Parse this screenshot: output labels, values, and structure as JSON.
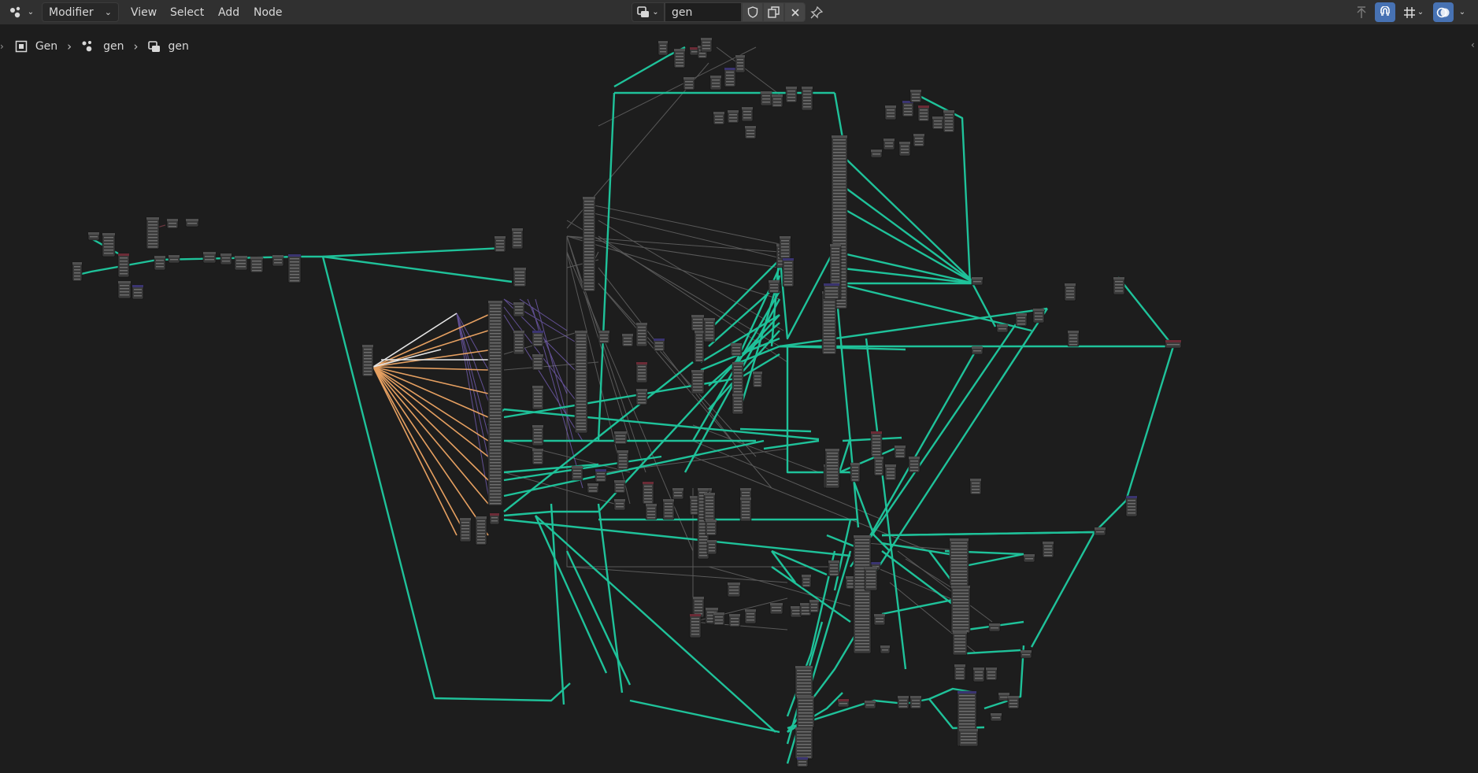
{
  "header": {
    "editor_type_icon": "node-editor-icon",
    "mode_label": "Modifier",
    "menus": [
      "View",
      "Select",
      "Add",
      "Node"
    ],
    "node_tree_name": "gen",
    "node_tree_icon": "geometry-nodes-icon",
    "right_icons": [
      "parent-node-icon",
      "snap-icon",
      "grid-overlay-icon",
      "overlay-icon"
    ]
  },
  "breadcrumb": {
    "items": [
      {
        "icon": "mesh-object-icon",
        "label": "Gen"
      },
      {
        "icon": "modifier-icon",
        "label": "gen"
      },
      {
        "icon": "node-tree-icon",
        "label": "gen"
      }
    ]
  },
  "colors": {
    "link_geometry": "#1fc29a",
    "link_float": "#8c8c8c",
    "link_vector": "#8066c9",
    "link_integer": "#e6a061",
    "link_bool": "#f0f0f0",
    "node_body": "#3a3a3a",
    "active_header": "#4772b3"
  }
}
